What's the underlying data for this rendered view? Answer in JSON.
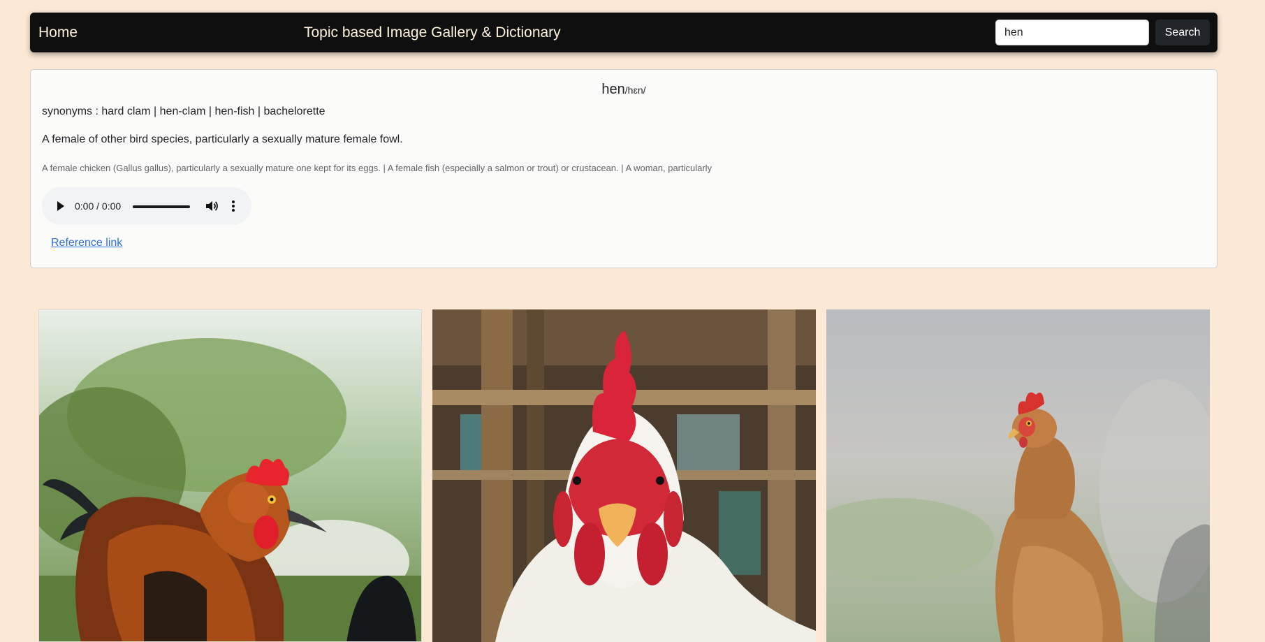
{
  "nav": {
    "home_label": "Home",
    "title": "Topic based Image Gallery & Dictionary",
    "search_value": "hen",
    "search_button_label": "Search"
  },
  "dictionary": {
    "word": "hen",
    "phonetic": "/hɛn/",
    "synonyms": "synonyms : hard clam | hen-clam | hen-fish | bachelorette",
    "definition": "A female of other bird species, particularly a sexually mature female fowl.",
    "more_definitions": "A female chicken (Gallus gallus), particularly a sexually mature one kept for its eggs. | A female fish (especially a salmon or trout) or crustacean. | A woman, particularly",
    "audio_time": "0:00 / 0:00",
    "reference_link_label": "Reference link"
  },
  "gallery": {
    "images": [
      {
        "icon": "rooster-photo",
        "subject": "dark rooster with red comb in garden"
      },
      {
        "icon": "rooster-photo",
        "subject": "white rooster with red comb in coop"
      },
      {
        "icon": "hen-photo",
        "subject": "brown hen outdoors"
      }
    ]
  },
  "colors": {
    "page_background": "#fbe9d6",
    "navbar_background": "#0f0f0f",
    "navbar_text": "#fff3de",
    "link": "#2f6fd1"
  }
}
